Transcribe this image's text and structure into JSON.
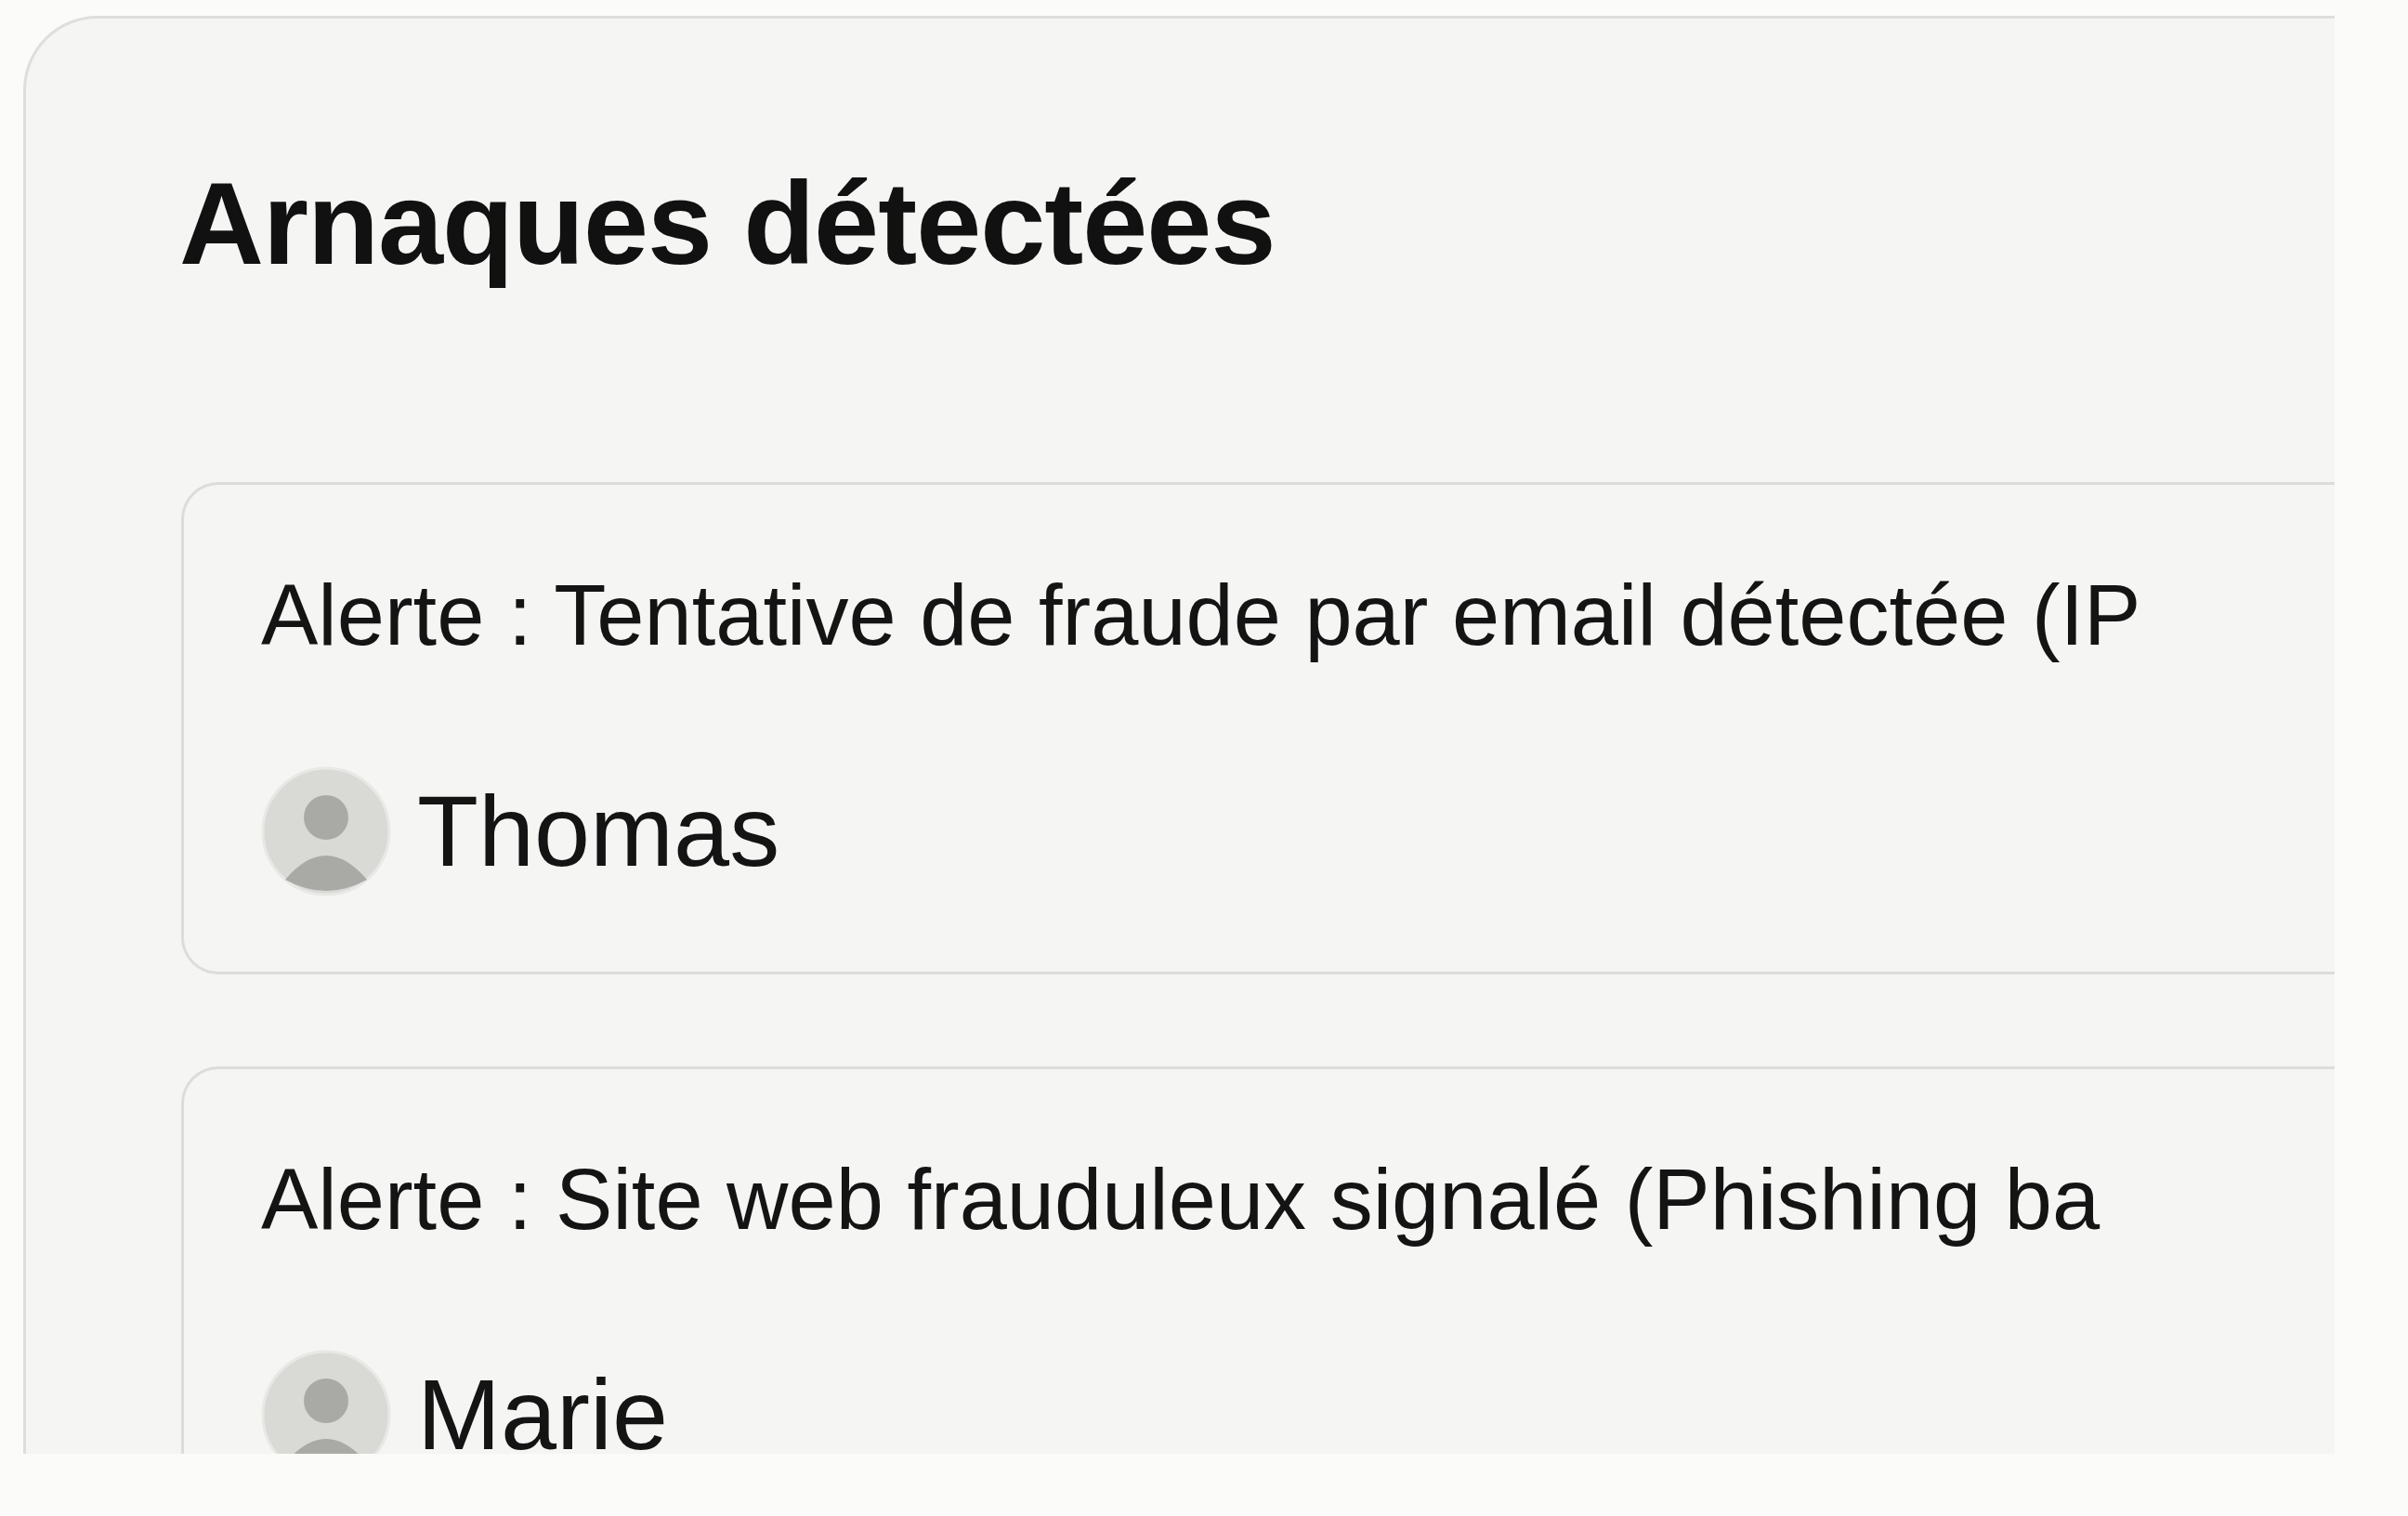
{
  "title": "Arnaques détectées",
  "alerts": [
    {
      "text": "Alerte : Tentative de fraude par email détectée (IP",
      "person": "Thomas"
    },
    {
      "text": "Alerte : Site web frauduleux signalé (Phishing ba",
      "person": "Marie"
    }
  ]
}
